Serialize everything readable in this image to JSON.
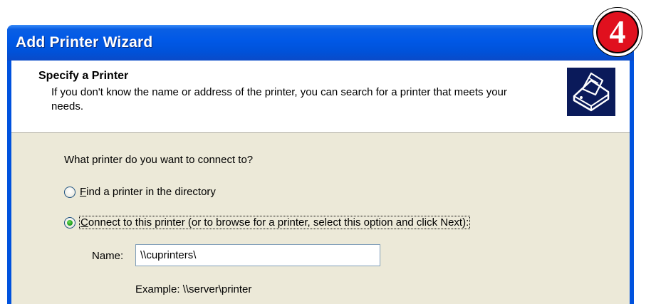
{
  "window": {
    "title": "Add Printer Wizard"
  },
  "header": {
    "title": "Specify a Printer",
    "description": "If you don't know the name or address of the printer, you can search for a printer that meets your needs.",
    "icon": "printer-icon"
  },
  "body": {
    "question": "What printer do you want to connect to?",
    "options": [
      {
        "accel": "F",
        "rest": "ind a printer in the directory",
        "checked": false
      },
      {
        "accel": "C",
        "rest": "onnect to this printer (or to browse for a printer, select this option and click Next):",
        "checked": true
      }
    ],
    "name_label": "Name:",
    "name_value": "\\\\cuprinters\\",
    "example": "Example: \\\\server\\printer"
  },
  "badge": {
    "number": "4",
    "color": "#e0101e"
  }
}
